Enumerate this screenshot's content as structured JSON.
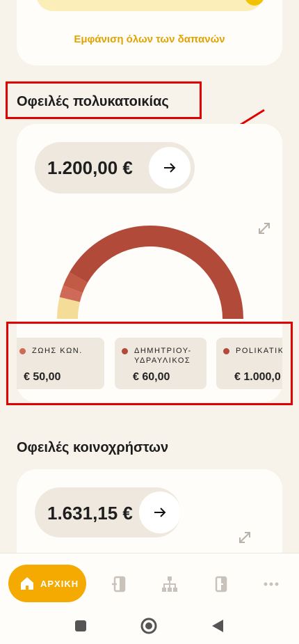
{
  "expenses_card": {
    "show_all_label": "Εμφάνιση όλων των δαπανών"
  },
  "building_debts": {
    "title": "Οφειλές πολυκατοικίας",
    "amount": "1.200,00 €",
    "chart_data": {
      "type": "pie",
      "variant": "half-donut",
      "slices": [
        {
          "label": "ΖΩΗΣ ΚΩΝ.",
          "value": 50.0,
          "color": "#cf6a58"
        },
        {
          "label": "ΔΗΜΗΤΡΙΟΥ-ΥΔΡΑΥΛΙΚΟΣ",
          "value": 60.0,
          "color": "#c25a46"
        },
        {
          "label": "POLIKATIKI",
          "value": 1000.0,
          "color": "#b24a3a"
        },
        {
          "label": "",
          "value": 90.0,
          "color": "#f4dd98"
        }
      ]
    },
    "legend": [
      {
        "label": "ΖΩΗΣ ΚΩΝ.",
        "value": "€ 50,00",
        "color": "#cf6a58"
      },
      {
        "label": "ΔΗΜΗΤΡΙΟΥ-\nΥΔΡΑΥΛΙΚΟΣ",
        "value": "€ 60,00",
        "color": "#b24a3a"
      },
      {
        "label": "POLIKATIKI",
        "value": "€ 1.000,0",
        "color": "#b24a3a"
      }
    ]
  },
  "common_debts": {
    "title": "Οφειλές κοινοχρήστων",
    "amount": "1.631,15 €"
  },
  "nav": {
    "home_label": "ΑΡΧΙΚΗ",
    "accent": "#f4aa00"
  }
}
